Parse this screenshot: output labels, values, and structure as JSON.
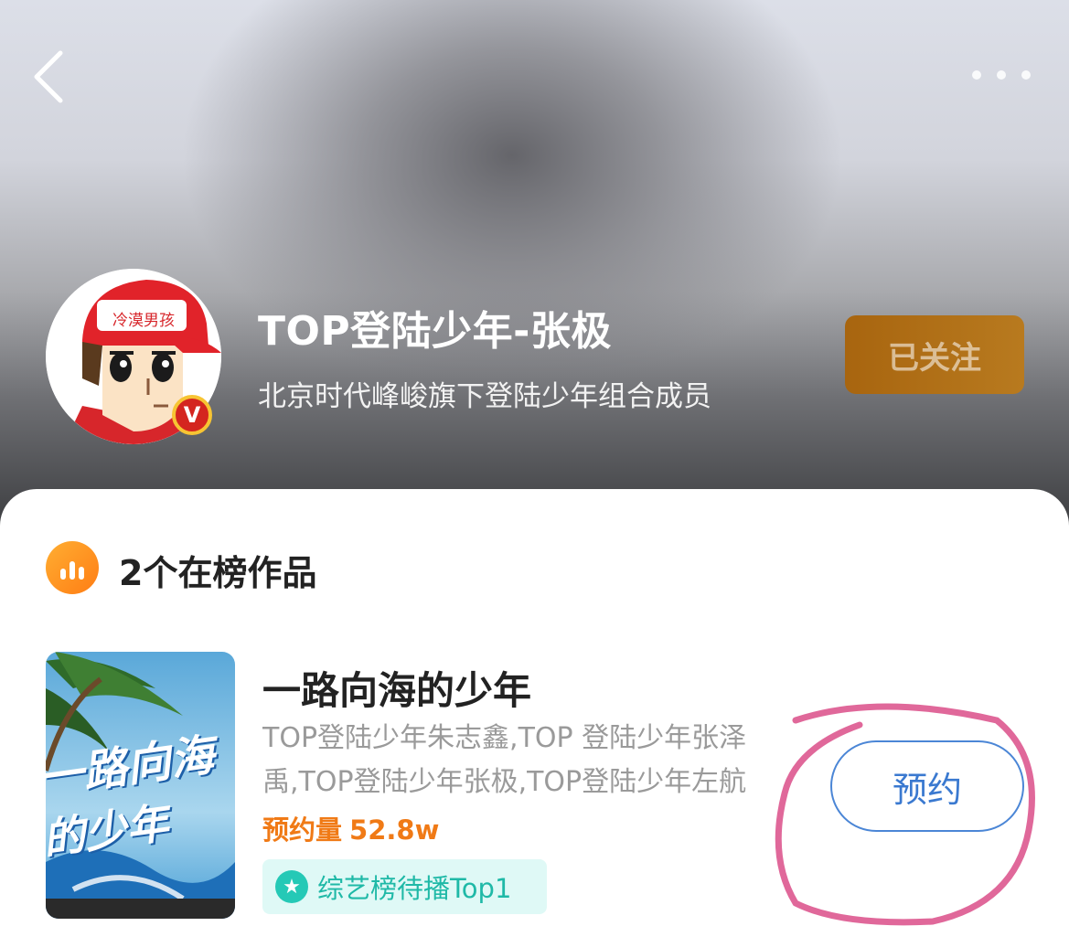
{
  "nav": {
    "back_icon": "chevron-left-icon",
    "more_icon": "more-dots-icon"
  },
  "profile": {
    "avatar_cap_text": "冷漠男孩",
    "verified_badge": "V",
    "name": "TOP登陆少年-张极",
    "description": "北京时代峰峻旗下登陆少年组合成员",
    "follow_label": "已关注"
  },
  "section": {
    "icon": "chart-bars-icon",
    "title": "2个在榜作品"
  },
  "show": {
    "poster_text_line1": "一路向海",
    "poster_text_line2": "的少年",
    "title": "一路向海的少年",
    "cast_line1": "TOP登陆少年朱志鑫,TOP 登陆少年张泽",
    "cast_line2": "禹,TOP登陆少年张极,TOP登陆少年左航",
    "booking_label": "预约量",
    "booking_value": "52.8w",
    "rank_tag": "综艺榜待播Top1",
    "reserve_label": "预约"
  },
  "colors": {
    "accent_orange": "#f07a16",
    "reserve_blue": "#3a79d0",
    "tag_teal": "#1fb9a7",
    "annotation_pink": "#e0689a"
  }
}
